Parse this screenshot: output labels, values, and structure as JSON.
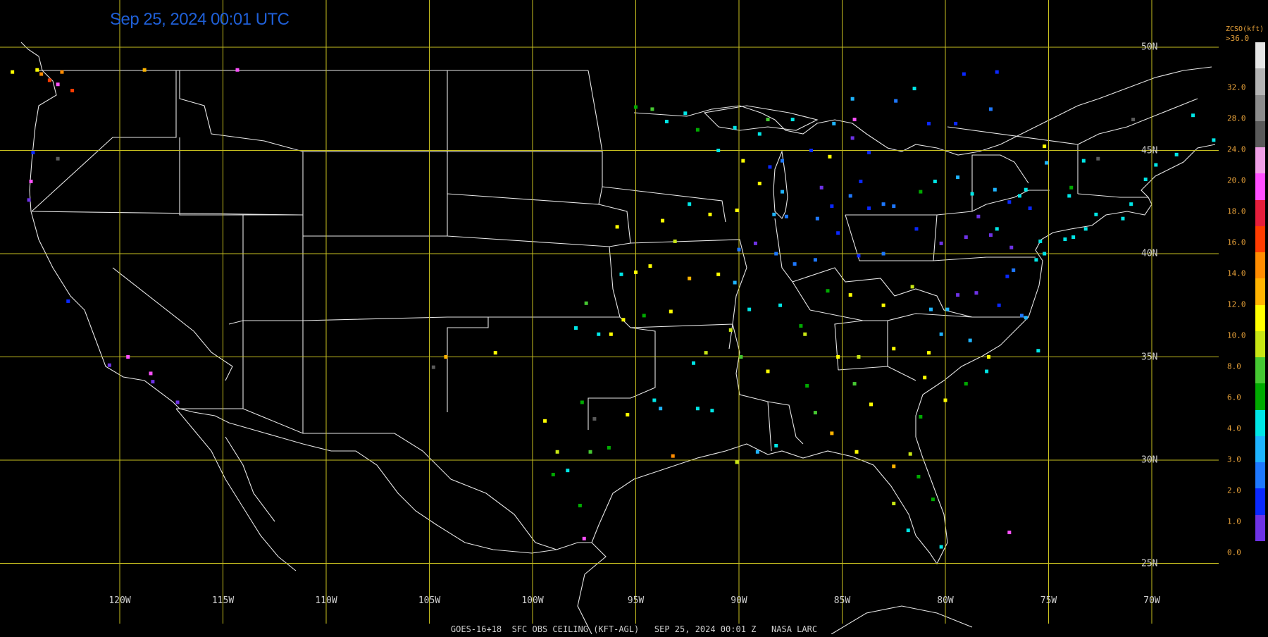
{
  "header": {
    "timestamp": "Sep 25, 2024 00:01 UTC"
  },
  "footer": {
    "caption": "GOES-16+18  SFC OBS CEILING (KFT-AGL)   SEP 25, 2024 00:01 Z   NASA LARC"
  },
  "grid": {
    "longitudes": [
      {
        "value": -120,
        "label": "120W"
      },
      {
        "value": -115,
        "label": "115W"
      },
      {
        "value": -110,
        "label": "110W"
      },
      {
        "value": -105,
        "label": "105W"
      },
      {
        "value": -100,
        "label": "100W"
      },
      {
        "value": -95,
        "label": "95W"
      },
      {
        "value": -90,
        "label": "90W"
      },
      {
        "value": -85,
        "label": "85W"
      },
      {
        "value": -80,
        "label": "80W"
      },
      {
        "value": -75,
        "label": "75W"
      },
      {
        "value": -70,
        "label": "70W"
      }
    ],
    "latitudes": [
      {
        "value": 50,
        "label": "50N"
      },
      {
        "value": 45,
        "label": "45N"
      },
      {
        "value": 40,
        "label": "40N"
      },
      {
        "value": 35,
        "label": "35N"
      },
      {
        "value": 30,
        "label": "30N"
      },
      {
        "value": 25,
        "label": "25N"
      }
    ],
    "color": "#c8c020"
  },
  "legend": {
    "title": "ZCSO(kft)",
    "top_label": ">36.0",
    "ticks": [
      "32.0",
      "28.0",
      "24.0",
      "20.0",
      "18.0",
      "16.0",
      "14.0",
      "12.0",
      "10.0",
      "8.0",
      "6.0",
      "4.0",
      "3.0",
      "2.0",
      "1.0",
      "0.0"
    ],
    "colors": [
      "#e6e6e6",
      "#b4b4b4",
      "#8c8c8c",
      "#5a5a5a",
      "#f0a0e6",
      "#ff50ff",
      "#e61e3c",
      "#ff3c00",
      "#ff8c00",
      "#ffb400",
      "#ffff00",
      "#c8e614",
      "#46c832",
      "#00aa00",
      "#00e6e6",
      "#1eb4ff",
      "#1e78ff",
      "#0a28ff",
      "#6e32e6"
    ]
  },
  "observations": {
    "note_levels": [
      0.5,
      1.5,
      2.5,
      3.5,
      5,
      7,
      9,
      11,
      13,
      15,
      17,
      19,
      22,
      26,
      30,
      34
    ],
    "points": [
      [
        -124.0,
        48.9,
        11
      ],
      [
        -123.8,
        48.7,
        15
      ],
      [
        -123.4,
        48.4,
        16
      ],
      [
        -122.8,
        48.8,
        14
      ],
      [
        -123.0,
        48.2,
        20
      ],
      [
        -122.3,
        47.9,
        17
      ],
      [
        -118.8,
        48.9,
        12
      ],
      [
        -125.2,
        48.8,
        11
      ],
      [
        -124.2,
        44.9,
        1
      ],
      [
        -124.3,
        43.5,
        22
      ],
      [
        -123.0,
        44.6,
        30
      ],
      [
        -124.4,
        42.6,
        0.5
      ],
      [
        -120.5,
        34.6,
        0.5
      ],
      [
        -118.5,
        34.2,
        20
      ],
      [
        -118.4,
        33.8,
        0.5
      ],
      [
        -117.2,
        32.8,
        0.5
      ],
      [
        -119.6,
        35.0,
        22
      ],
      [
        -122.5,
        37.7,
        1
      ],
      [
        -114.3,
        48.9,
        20
      ],
      [
        -95.0,
        47.1,
        6
      ],
      [
        -94.2,
        47.0,
        7
      ],
      [
        -93.5,
        46.4,
        5
      ],
      [
        -92.6,
        46.8,
        4
      ],
      [
        -92.0,
        46.0,
        6
      ],
      [
        -91.0,
        45.0,
        5
      ],
      [
        -90.2,
        46.1,
        4
      ],
      [
        -88.6,
        46.5,
        7
      ],
      [
        -89.8,
        44.5,
        10
      ],
      [
        -89.0,
        43.4,
        10
      ],
      [
        -90.1,
        42.1,
        11
      ],
      [
        -91.4,
        41.9,
        10
      ],
      [
        -92.4,
        42.4,
        5
      ],
      [
        -93.7,
        41.6,
        11
      ],
      [
        -95.9,
        41.3,
        10
      ],
      [
        -93.1,
        40.6,
        9
      ],
      [
        -94.3,
        39.4,
        11
      ],
      [
        -92.4,
        38.8,
        12
      ],
      [
        -90.2,
        38.6,
        3
      ],
      [
        -93.3,
        37.2,
        10
      ],
      [
        -94.6,
        37.0,
        6
      ],
      [
        -96.2,
        36.1,
        10
      ],
      [
        -95.6,
        36.8,
        11
      ],
      [
        -97.4,
        37.6,
        7
      ],
      [
        -97.9,
        36.4,
        5
      ],
      [
        -95.0,
        39.1,
        11
      ],
      [
        -95.7,
        39.0,
        4
      ],
      [
        -96.8,
        36.1,
        5
      ],
      [
        -97.6,
        32.8,
        6
      ],
      [
        -95.4,
        32.2,
        10
      ],
      [
        -96.3,
        30.6,
        6
      ],
      [
        -97.2,
        30.4,
        7
      ],
      [
        -98.3,
        29.5,
        5
      ],
      [
        -99.4,
        31.9,
        11
      ],
      [
        -101.8,
        35.2,
        10
      ],
      [
        -104.2,
        35.0,
        12
      ],
      [
        -104.8,
        34.5,
        30
      ],
      [
        -97.0,
        32.0,
        30
      ],
      [
        -94.1,
        32.9,
        4
      ],
      [
        -93.2,
        30.2,
        14
      ],
      [
        -93.8,
        32.5,
        3
      ],
      [
        -92.0,
        32.5,
        4
      ],
      [
        -91.3,
        32.4,
        4
      ],
      [
        -89.1,
        30.4,
        3
      ],
      [
        -90.1,
        29.9,
        8
      ],
      [
        -88.2,
        30.7,
        4
      ],
      [
        -86.7,
        33.6,
        6
      ],
      [
        -86.3,
        32.3,
        7
      ],
      [
        -85.5,
        31.3,
        12
      ],
      [
        -84.4,
        33.7,
        7
      ],
      [
        -83.6,
        32.7,
        10
      ],
      [
        -81.2,
        32.1,
        6
      ],
      [
        -80.0,
        32.9,
        10
      ],
      [
        -81.0,
        34.0,
        11
      ],
      [
        -79.0,
        33.7,
        6
      ],
      [
        -78.0,
        34.3,
        4
      ],
      [
        -77.9,
        35.0,
        11
      ],
      [
        -78.8,
        35.8,
        3
      ],
      [
        -80.2,
        36.1,
        3
      ],
      [
        -80.8,
        35.2,
        11
      ],
      [
        -82.5,
        35.4,
        11
      ],
      [
        -84.2,
        35.0,
        8
      ],
      [
        -85.2,
        35.0,
        11
      ],
      [
        -86.8,
        36.1,
        8
      ],
      [
        -85.7,
        38.2,
        6
      ],
      [
        -84.6,
        38.0,
        11
      ],
      [
        -83.0,
        37.5,
        10
      ],
      [
        -81.6,
        38.4,
        8
      ],
      [
        -80.7,
        37.3,
        3
      ],
      [
        -79.9,
        37.3,
        3
      ],
      [
        -79.4,
        38.0,
        0.5
      ],
      [
        -78.5,
        38.1,
        0.5
      ],
      [
        -77.4,
        37.5,
        1
      ],
      [
        -76.3,
        37.0,
        2
      ],
      [
        -76.1,
        36.9,
        3
      ],
      [
        -75.5,
        35.3,
        4
      ],
      [
        -77.0,
        38.9,
        1
      ],
      [
        -76.7,
        39.2,
        2
      ],
      [
        -75.6,
        39.7,
        5
      ],
      [
        -75.2,
        40.0,
        4
      ],
      [
        -74.2,
        40.7,
        4
      ],
      [
        -73.8,
        40.8,
        5
      ],
      [
        -73.2,
        41.2,
        4
      ],
      [
        -72.7,
        41.9,
        4
      ],
      [
        -71.4,
        41.7,
        4
      ],
      [
        -71.0,
        42.4,
        4
      ],
      [
        -70.3,
        43.6,
        4
      ],
      [
        -69.8,
        44.3,
        4
      ],
      [
        -68.8,
        44.8,
        5
      ],
      [
        -68.0,
        46.7,
        5
      ],
      [
        -72.6,
        44.6,
        31
      ],
      [
        -73.3,
        44.5,
        4
      ],
      [
        -74.0,
        42.8,
        5
      ],
      [
        -75.9,
        42.2,
        1
      ],
      [
        -76.1,
        43.1,
        4
      ],
      [
        -77.6,
        43.1,
        3
      ],
      [
        -78.7,
        42.9,
        5
      ],
      [
        -79.4,
        43.7,
        3
      ],
      [
        -80.5,
        43.5,
        5
      ],
      [
        -81.2,
        43.0,
        6
      ],
      [
        -82.5,
        42.3,
        2
      ],
      [
        -83.0,
        42.4,
        2
      ],
      [
        -83.7,
        42.2,
        1
      ],
      [
        -84.6,
        42.8,
        2
      ],
      [
        -85.5,
        42.3,
        1
      ],
      [
        -86.2,
        41.7,
        2
      ],
      [
        -87.7,
        41.8,
        2
      ],
      [
        -88.3,
        41.9,
        3
      ],
      [
        -89.2,
        40.5,
        0.5
      ],
      [
        -88.2,
        40.0,
        2
      ],
      [
        -87.3,
        39.5,
        2
      ],
      [
        -86.3,
        39.7,
        2
      ],
      [
        -85.2,
        41.0,
        1
      ],
      [
        -84.2,
        39.9,
        1
      ],
      [
        -83.0,
        40.0,
        2
      ],
      [
        -81.4,
        41.2,
        1
      ],
      [
        -80.2,
        40.5,
        0.5
      ],
      [
        -79.0,
        40.8,
        0.5
      ],
      [
        -77.8,
        40.9,
        0.5
      ],
      [
        -76.8,
        40.3,
        0.5
      ],
      [
        -75.4,
        40.6,
        5
      ],
      [
        -77.5,
        41.2,
        5
      ],
      [
        -78.4,
        41.8,
        0.5
      ],
      [
        -86.5,
        45.0,
        1
      ],
      [
        -85.6,
        44.7,
        10
      ],
      [
        -84.5,
        45.6,
        0.5
      ],
      [
        -84.4,
        46.5,
        22
      ],
      [
        -85.4,
        46.3,
        3
      ],
      [
        -87.4,
        46.5,
        5
      ],
      [
        -89.0,
        45.8,
        5
      ],
      [
        -87.9,
        44.5,
        2
      ],
      [
        -87.9,
        43.0,
        3
      ],
      [
        -88.5,
        44.2,
        1
      ],
      [
        -84.1,
        43.5,
        1
      ],
      [
        -83.7,
        44.9,
        1
      ],
      [
        -86.0,
        43.2,
        0.5
      ],
      [
        -90.0,
        40.2,
        2
      ],
      [
        -91.0,
        39.0,
        10
      ],
      [
        -89.5,
        37.3,
        5
      ],
      [
        -88.0,
        37.5,
        4
      ],
      [
        -87.0,
        36.5,
        6
      ],
      [
        -89.9,
        35.0,
        7
      ],
      [
        -88.6,
        34.3,
        10
      ],
      [
        -90.4,
        36.3,
        8
      ],
      [
        -91.6,
        35.2,
        8
      ],
      [
        -92.2,
        34.7,
        5
      ],
      [
        -80.2,
        25.8,
        4
      ],
      [
        -81.8,
        26.6,
        5
      ],
      [
        -82.5,
        27.9,
        8
      ],
      [
        -80.6,
        28.1,
        6
      ],
      [
        -81.3,
        29.2,
        6
      ],
      [
        -84.3,
        30.4,
        11
      ],
      [
        -82.5,
        29.7,
        12
      ],
      [
        -81.7,
        30.3,
        8
      ],
      [
        -76.9,
        26.5,
        20
      ],
      [
        -97.5,
        26.2,
        20
      ],
      [
        -97.7,
        27.8,
        6
      ],
      [
        -98.8,
        30.4,
        8
      ],
      [
        -99.0,
        29.3,
        6
      ],
      [
        -80.8,
        46.3,
        1
      ],
      [
        -79.5,
        46.3,
        1
      ],
      [
        -77.8,
        47.0,
        2
      ],
      [
        -81.5,
        48.0,
        4
      ],
      [
        -82.4,
        47.4,
        2
      ],
      [
        -79.1,
        48.7,
        1
      ],
      [
        -77.5,
        48.8,
        1
      ],
      [
        -84.5,
        47.5,
        3
      ],
      [
        -76.9,
        42.5,
        1
      ],
      [
        -76.4,
        42.8,
        4
      ],
      [
        -75.1,
        44.4,
        3
      ],
      [
        -73.9,
        43.2,
        6
      ],
      [
        -67.0,
        45.5,
        4
      ],
      [
        -66.2,
        45.2,
        4
      ],
      [
        -70.9,
        46.5,
        30
      ],
      [
        -75.2,
        45.2,
        10
      ]
    ]
  }
}
